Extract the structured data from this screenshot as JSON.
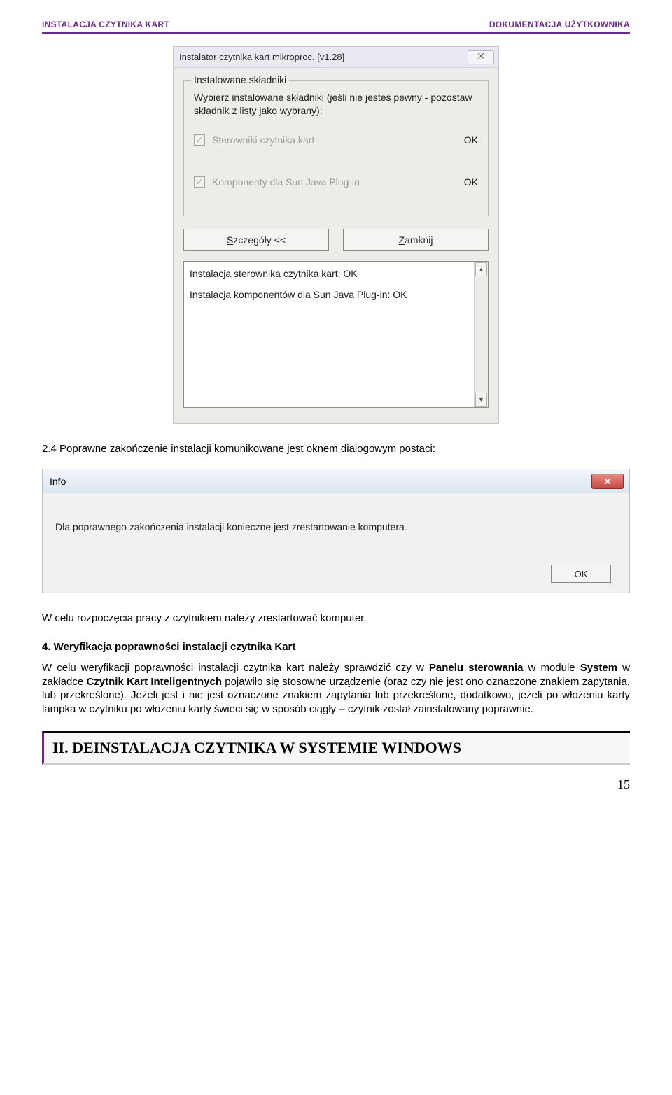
{
  "header": {
    "left": "INSTALACJA CZYTNIKA KART",
    "right": "DOKUMENTACJA UŻYTKOWNIKA"
  },
  "installer": {
    "title": "Instalator czytnika kart mikroproc. [v1.28]",
    "closeGlyph": "⨉",
    "legend": "Instalowane składniki",
    "instruction": "Wybierz instalowane składniki (jeśli nie jesteś pewny - pozostaw składnik z listy jako wybrany):",
    "components": [
      {
        "label": "Sterowniki czytnika kart",
        "status": "OK"
      },
      {
        "label": "Komponenty dla Sun Java Plug-in",
        "status": "OK"
      }
    ],
    "checkGlyph": "✓",
    "btnDetailsPrefix": "S",
    "btnDetailsRest": "zczegóły <<",
    "btnClosePrefix": "Z",
    "btnCloseRest": "amknij",
    "log": {
      "line1": "Instalacja sterownika czytnika kart: OK",
      "line2": "Instalacja komponentów dla Sun Java Plug-in: OK"
    },
    "sbUp": "▲",
    "sbDown": "▼"
  },
  "para24": {
    "lead": "2.4 ",
    "text": "Poprawne zakończenie instalacji komunikowane jest oknem dialogowym postaci:"
  },
  "info": {
    "title": "Info",
    "message": "Dla poprawnego zakończenia instalacji konieczne jest zrestartowanie komputera.",
    "ok": "OK"
  },
  "afterInfo": "W celu rozpoczęcia pracy z czytnikiem należy zrestartować komputer.",
  "sec4": {
    "title": "4. Weryfikacja poprawności instalacji czytnika Kart",
    "p1a": "W celu weryfikacji poprawności instalacji czytnika kart należy sprawdzić czy w ",
    "p1b_bold": "Panelu sterowania",
    "p1c": " w module ",
    "p1d_bold": "System",
    "p1e": " w zakładce ",
    "p1f_bold": "Czytnik Kart Inteligentnych",
    "p1g": " pojawiło się stosowne urządzenie (oraz czy nie jest ono oznaczone znakiem zapytania, lub przekreślone). Jeżeli jest i nie jest oznaczone znakiem zapytania lub przekreślone, dodatkowo, jeżeli po włożeniu karty lampka w czytniku po włożeniu karty świeci się w sposób ciągły – czytnik został zainstalowany poprawnie."
  },
  "sectionHeading": "II. DEINSTALACJA CZYTNIKA W SYSTEMIE WINDOWS",
  "pageNumber": "15"
}
